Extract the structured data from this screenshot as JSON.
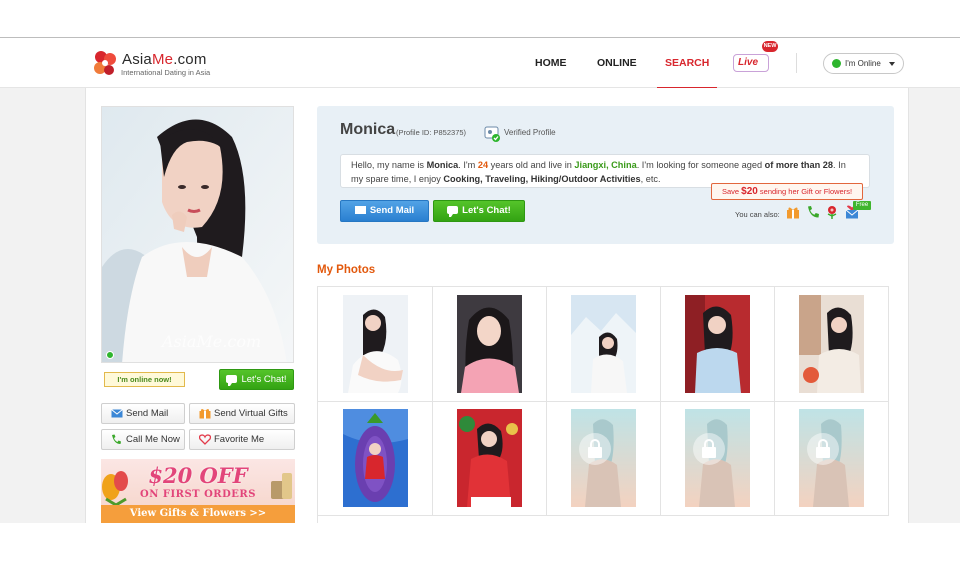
{
  "brand": {
    "name_a": "Asia",
    "name_b": "Me",
    "name_c": ".com",
    "tagline": "International Dating in Asia"
  },
  "nav": {
    "home": "HOME",
    "online": "ONLINE",
    "search": "SEARCH",
    "live_label": "Live",
    "live_badge": "NEW",
    "status_label": "I'm Online",
    "active_item": "SEARCH"
  },
  "sidebar": {
    "watermark": "AsiaMe.com",
    "online_tag": "I'm online now!",
    "chat_label": "Let's Chat!",
    "actions": [
      {
        "label": "Send Mail",
        "icon": "mail-icon"
      },
      {
        "label": "Send Virtual Gifts",
        "icon": "gift-icon"
      },
      {
        "label": "Call Me Now",
        "icon": "phone-icon"
      },
      {
        "label": "Favorite Me",
        "icon": "heart-icon"
      }
    ],
    "promo": {
      "title": "$20 OFF",
      "subtitle": "ON FIRST ORDERS",
      "cta": "View Gifts & Flowers  >>"
    }
  },
  "profile": {
    "name": "Monica",
    "profile_id": "(Profile ID: P852375)",
    "verified": "Verified Profile",
    "intro": {
      "p1": "Hello, my name is ",
      "name": "Monica",
      "p2": ". I'm ",
      "age": "24",
      "p3": " years old and live in ",
      "location": "Jiangxi, China",
      "p4": ". I'm looking for someone aged ",
      "pref": "of more than 28",
      "p5": ". In my spare time, I enjoy ",
      "hobbies": "Cooking, Traveling, Hiking/Outdoor Activities",
      "p6": ", etc."
    },
    "send_mail": "Send Mail",
    "lets_chat": "Let's Chat!",
    "save_tip": {
      "pre": "Save ",
      "amount": "$20",
      "post": " sending her Gift or Flowers!"
    },
    "also": "You can also:",
    "free": "Free"
  },
  "photos": {
    "title": "My Photos",
    "items": [
      {
        "kind": "photo",
        "locked": false
      },
      {
        "kind": "photo",
        "locked": false
      },
      {
        "kind": "photo",
        "locked": false
      },
      {
        "kind": "photo",
        "locked": false
      },
      {
        "kind": "photo",
        "locked": false
      },
      {
        "kind": "photo",
        "locked": false
      },
      {
        "kind": "photo",
        "locked": false
      },
      {
        "kind": "photo",
        "locked": true
      },
      {
        "kind": "photo",
        "locked": true
      },
      {
        "kind": "photo",
        "locked": true
      }
    ]
  },
  "colors": {
    "brand_red": "#d8262d",
    "accent_orange": "#e2580c",
    "online_green": "#2eb52e",
    "mail_blue": "#2a7fd0"
  }
}
